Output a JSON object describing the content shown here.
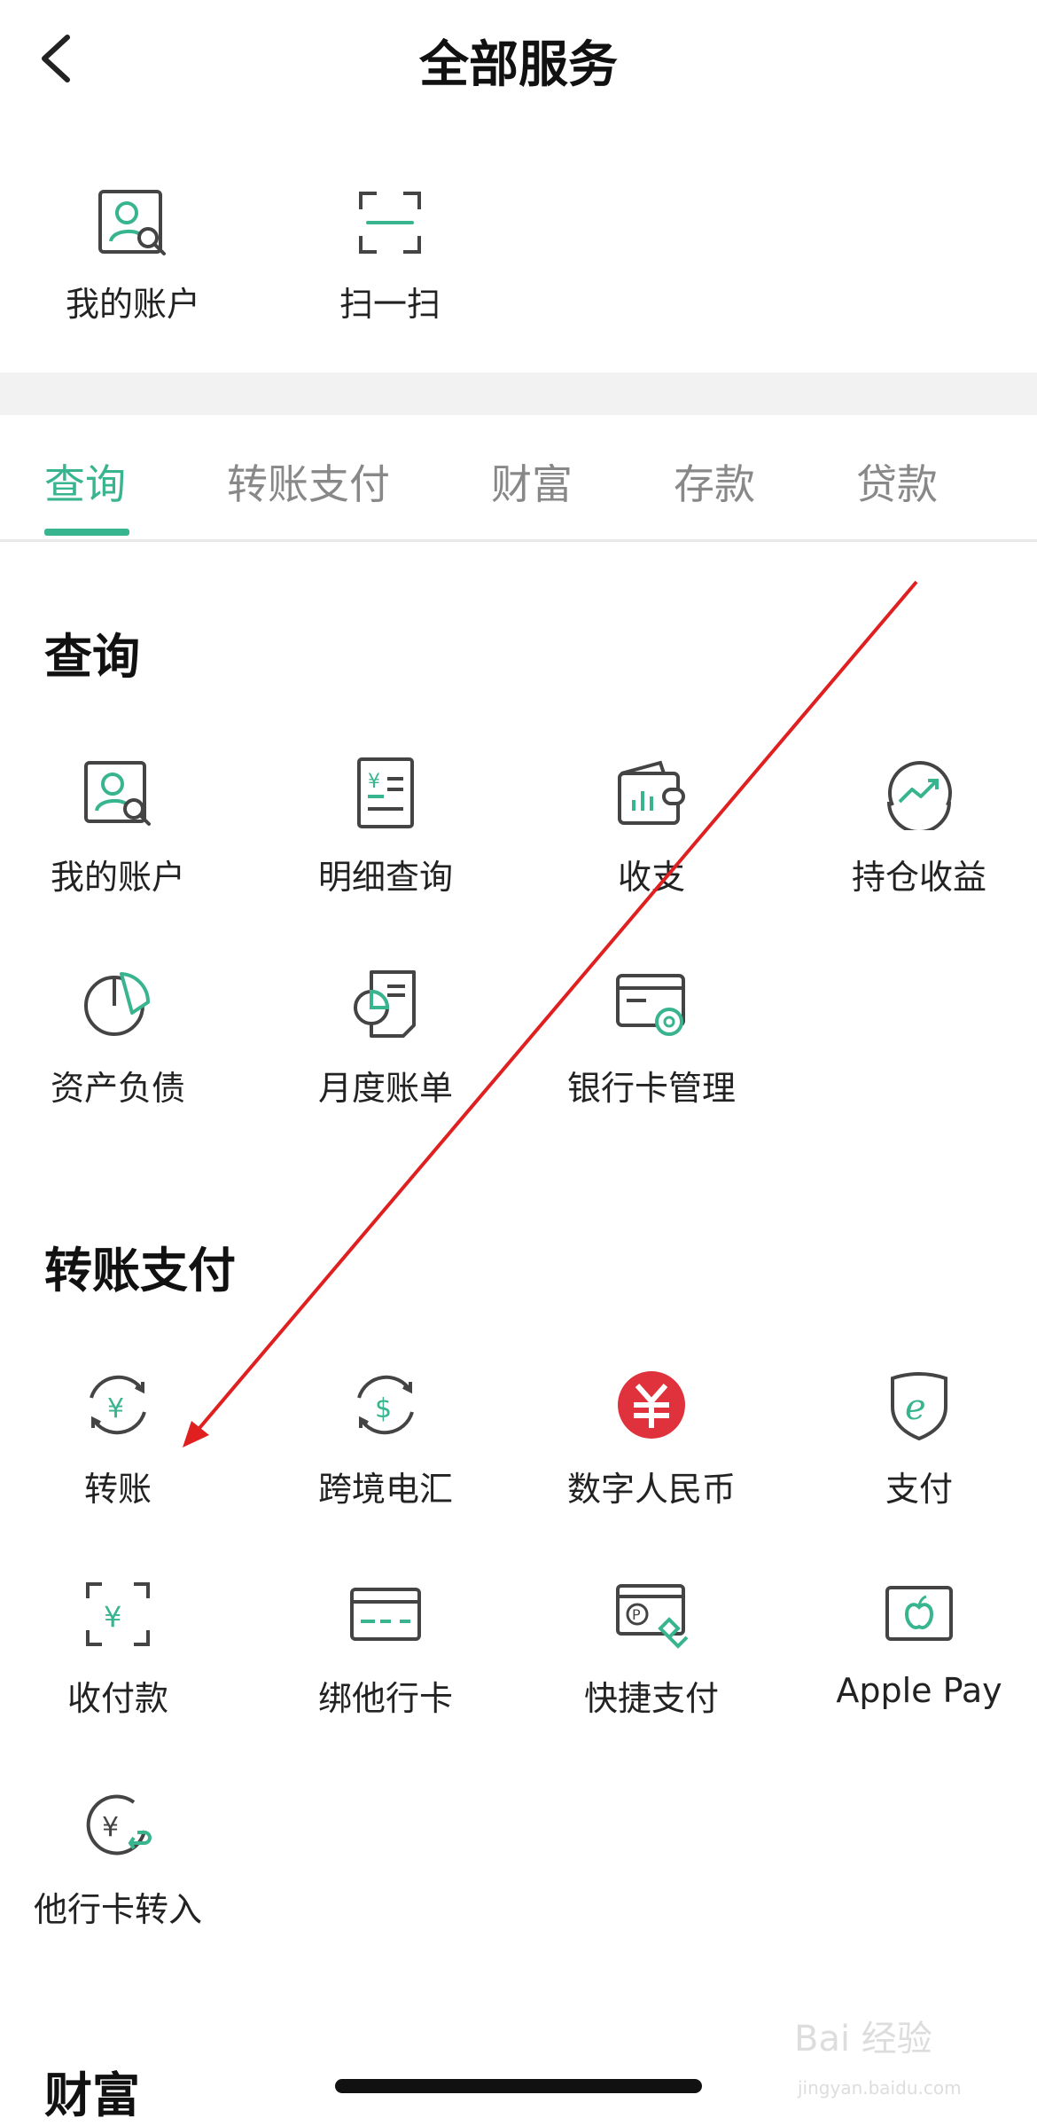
{
  "header": {
    "title": "全部服务"
  },
  "quick_actions": [
    {
      "label": "我的账户",
      "icon": "account-search-icon"
    },
    {
      "label": "扫一扫",
      "icon": "scan-icon"
    }
  ],
  "tabs": [
    {
      "label": "查询",
      "active": true
    },
    {
      "label": "转账支付",
      "active": false
    },
    {
      "label": "财富",
      "active": false
    },
    {
      "label": "存款",
      "active": false
    },
    {
      "label": "贷款",
      "active": false
    }
  ],
  "sections": {
    "query": {
      "title": "查询",
      "items": [
        {
          "label": "我的账户",
          "icon": "account-search-icon"
        },
        {
          "label": "明细查询",
          "icon": "statement-icon"
        },
        {
          "label": "收支",
          "icon": "wallet-chart-icon"
        },
        {
          "label": "持仓收益",
          "icon": "trend-up-icon"
        },
        {
          "label": "资产负债",
          "icon": "pie-chart-icon"
        },
        {
          "label": "月度账单",
          "icon": "bill-icon"
        },
        {
          "label": "银行卡管理",
          "icon": "card-settings-icon"
        }
      ]
    },
    "transfer": {
      "title": "转账支付",
      "items": [
        {
          "label": "转账",
          "icon": "yuan-transfer-icon"
        },
        {
          "label": "跨境电汇",
          "icon": "dollar-transfer-icon"
        },
        {
          "label": "数字人民币",
          "icon": "digital-rmb-icon"
        },
        {
          "label": "支付",
          "icon": "e-shield-icon"
        },
        {
          "label": "收付款",
          "icon": "scan-yuan-icon"
        },
        {
          "label": "绑他行卡",
          "icon": "card-icon"
        },
        {
          "label": "快捷支付",
          "icon": "quick-pay-icon"
        },
        {
          "label": "Apple Pay",
          "icon": "apple-pay-icon"
        },
        {
          "label": "他行卡转入",
          "icon": "yuan-return-icon"
        }
      ]
    },
    "wealth": {
      "title": "财富"
    }
  },
  "watermark": {
    "text": "Bai 经验",
    "sub": "jingyan.baidu.com"
  },
  "colors": {
    "accent": "#38b58f",
    "text": "#222222",
    "muted": "#888888",
    "arrow": "#e02020",
    "rmb": "#e0323c"
  }
}
